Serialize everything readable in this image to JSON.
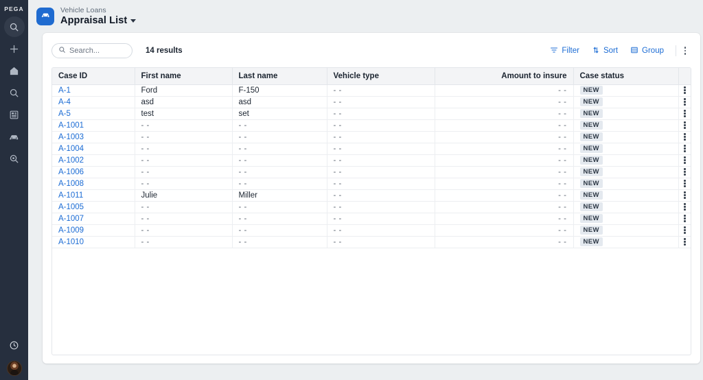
{
  "brand": {
    "logo_text": "PEGA",
    "accent": "#1a6bd4",
    "rail_bg": "#262f3e"
  },
  "sidebar": {
    "items": [
      {
        "name": "search-circle-icon",
        "label": "Search",
        "active": true
      },
      {
        "name": "plus-icon",
        "label": "Create"
      },
      {
        "name": "home-icon",
        "label": "Home"
      },
      {
        "name": "search-icon",
        "label": "Find"
      },
      {
        "name": "report-icon",
        "label": "Reports"
      },
      {
        "name": "car-icon",
        "label": "Vehicles"
      },
      {
        "name": "search-case-icon",
        "label": "Case search"
      }
    ],
    "bottom": [
      {
        "name": "recents-clock-icon",
        "label": "Recents"
      },
      {
        "name": "avatar",
        "label": "Profile"
      }
    ]
  },
  "header": {
    "app_icon": "car-icon",
    "breadcrumb": "Vehicle Loans",
    "title": "Appraisal List",
    "caret": "chevron-down-icon"
  },
  "toolbar": {
    "search_placeholder": "Search...",
    "search_value": "",
    "results_count": "14 results",
    "filter_label": "Filter",
    "sort_label": "Sort",
    "group_label": "Group",
    "more_label": "More actions"
  },
  "table": {
    "columns": [
      {
        "key": "case_id",
        "label": "Case ID",
        "align": "left"
      },
      {
        "key": "first_name",
        "label": "First name",
        "align": "left"
      },
      {
        "key": "last_name",
        "label": "Last name",
        "align": "left"
      },
      {
        "key": "vehicle_type",
        "label": "Vehicle type",
        "align": "left"
      },
      {
        "key": "amount_to_insure",
        "label": "Amount to insure",
        "align": "right"
      },
      {
        "key": "case_status",
        "label": "Case status",
        "align": "left"
      }
    ],
    "empty_value": "- -",
    "rows": [
      {
        "case_id": "A-1",
        "first_name": "Ford",
        "last_name": "F-150",
        "vehicle_type": "- -",
        "amount_to_insure": "- -",
        "case_status": "NEW"
      },
      {
        "case_id": "A-4",
        "first_name": "asd",
        "last_name": "asd",
        "vehicle_type": "- -",
        "amount_to_insure": "- -",
        "case_status": "NEW"
      },
      {
        "case_id": "A-5",
        "first_name": "test",
        "last_name": "set",
        "vehicle_type": "- -",
        "amount_to_insure": "- -",
        "case_status": "NEW"
      },
      {
        "case_id": "A-1001",
        "first_name": "- -",
        "last_name": "- -",
        "vehicle_type": "- -",
        "amount_to_insure": "- -",
        "case_status": "NEW"
      },
      {
        "case_id": "A-1003",
        "first_name": "- -",
        "last_name": "- -",
        "vehicle_type": "- -",
        "amount_to_insure": "- -",
        "case_status": "NEW"
      },
      {
        "case_id": "A-1004",
        "first_name": "- -",
        "last_name": "- -",
        "vehicle_type": "- -",
        "amount_to_insure": "- -",
        "case_status": "NEW"
      },
      {
        "case_id": "A-1002",
        "first_name": "- -",
        "last_name": "- -",
        "vehicle_type": "- -",
        "amount_to_insure": "- -",
        "case_status": "NEW"
      },
      {
        "case_id": "A-1006",
        "first_name": "- -",
        "last_name": "- -",
        "vehicle_type": "- -",
        "amount_to_insure": "- -",
        "case_status": "NEW"
      },
      {
        "case_id": "A-1008",
        "first_name": "- -",
        "last_name": "- -",
        "vehicle_type": "- -",
        "amount_to_insure": "- -",
        "case_status": "NEW"
      },
      {
        "case_id": "A-1011",
        "first_name": "Julie",
        "last_name": "Miller",
        "vehicle_type": "- -",
        "amount_to_insure": "- -",
        "case_status": "NEW"
      },
      {
        "case_id": "A-1005",
        "first_name": "- -",
        "last_name": "- -",
        "vehicle_type": "- -",
        "amount_to_insure": "- -",
        "case_status": "NEW"
      },
      {
        "case_id": "A-1007",
        "first_name": "- -",
        "last_name": "- -",
        "vehicle_type": "- -",
        "amount_to_insure": "- -",
        "case_status": "NEW"
      },
      {
        "case_id": "A-1009",
        "first_name": "- -",
        "last_name": "- -",
        "vehicle_type": "- -",
        "amount_to_insure": "- -",
        "case_status": "NEW"
      },
      {
        "case_id": "A-1010",
        "first_name": "- -",
        "last_name": "- -",
        "vehicle_type": "- -",
        "amount_to_insure": "- -",
        "case_status": "NEW"
      }
    ]
  }
}
